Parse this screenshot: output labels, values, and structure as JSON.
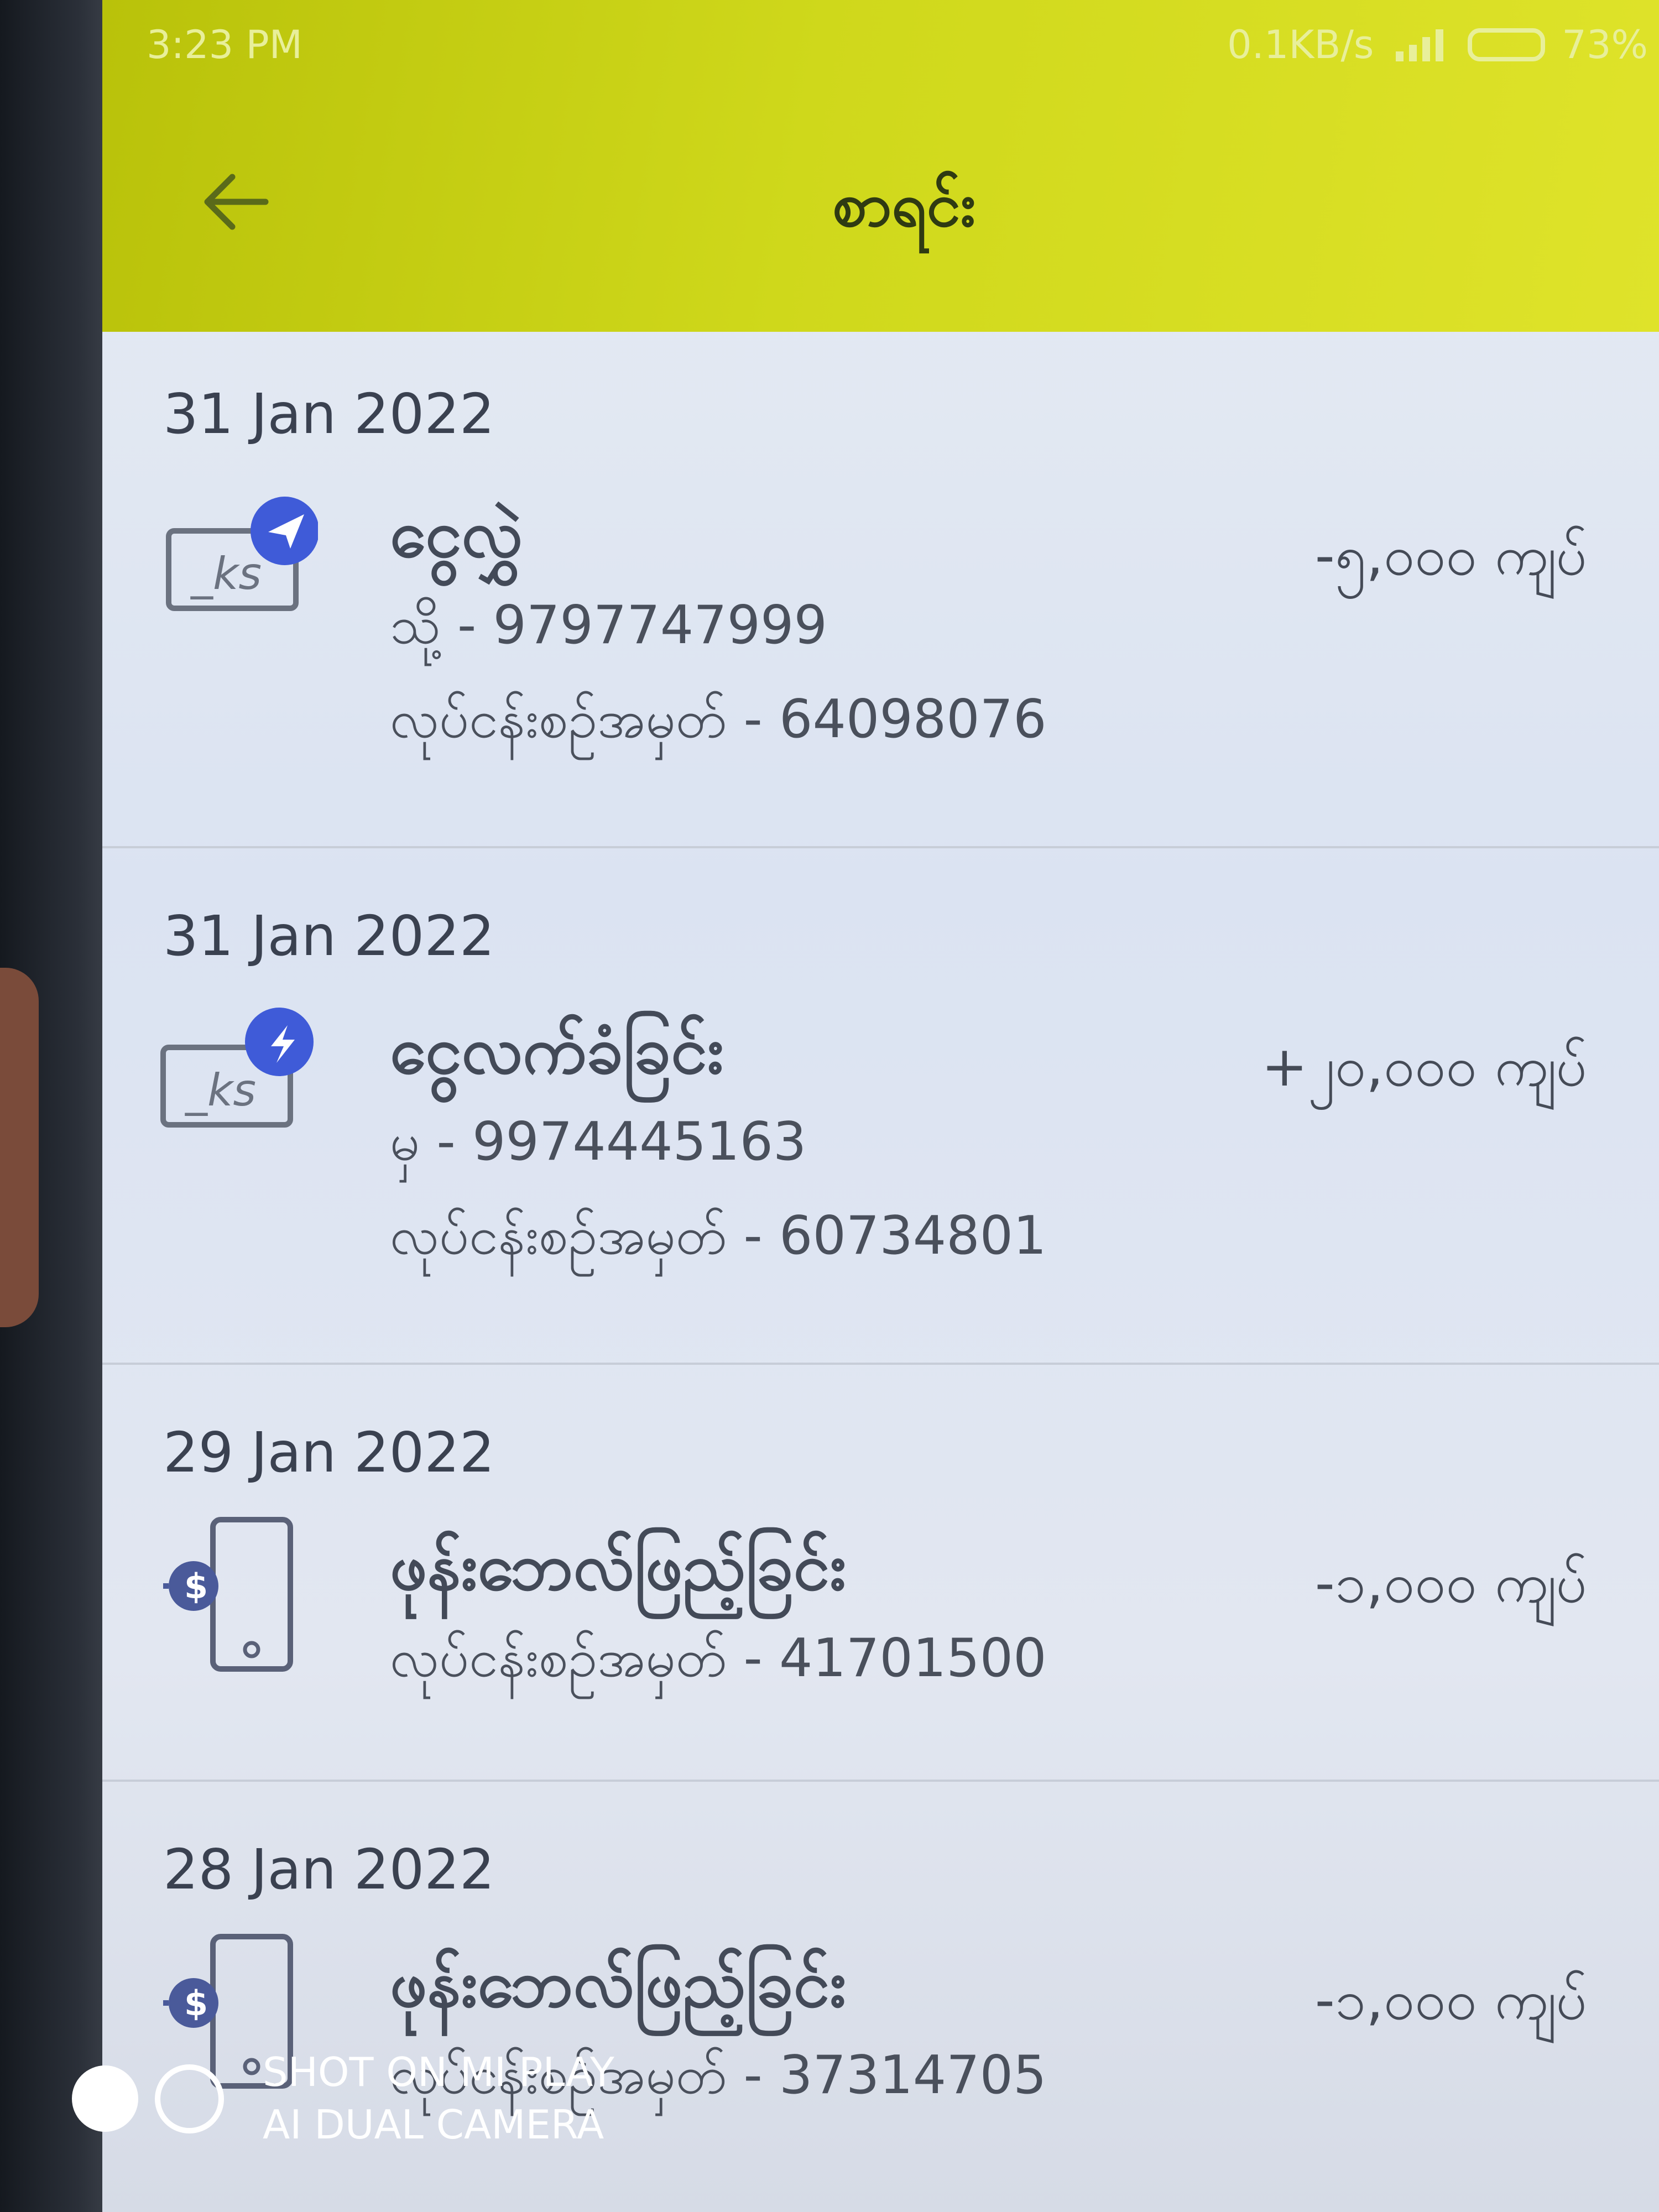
{
  "status_bar": {
    "time": "3:23 PM",
    "speed": "0.1KB/s",
    "battery": "73%"
  },
  "header": {
    "back_icon": "arrow-left-icon",
    "title": "စာရင်း"
  },
  "transactions": [
    {
      "date": "31 Jan 2022",
      "icon": "ks-send-icon",
      "title": "ငွေလွှဲ",
      "line1": "သို့ - 9797747999",
      "line2": "လုပ်ငန်းစဉ်အမှတ် - 64098076",
      "amount": "-၅,၀၀၀ ကျပ်"
    },
    {
      "date": "31 Jan 2022",
      "icon": "ks-receive-icon",
      "title": "ငွေလက်ခံခြင်း",
      "line1": "မှ - 9974445163",
      "line2": "လုပ်ငန်းစဉ်အမှတ် - 60734801",
      "amount": "+၂၀,၀၀၀ ကျပ်"
    },
    {
      "date": "29 Jan 2022",
      "icon": "phone-topup-icon",
      "title": "ဖုန်းဘေလ်ဖြည့်ခြင်း",
      "line1": "လုပ်ငန်းစဉ်အမှတ် - 41701500",
      "amount": "-၁,၀၀၀ ကျပ်"
    },
    {
      "date": "28 Jan 2022",
      "icon": "phone-topup-icon",
      "title": "ဖုန်းဘေလ်ဖြည့်ခြင်း",
      "line1": "လုပ်ငန်းစဉ်အမှတ် - 37314705",
      "amount": "-၁,၀၀၀ ကျပ်"
    }
  ],
  "watermark": {
    "line1": "SHOT ON MI PLAY",
    "line2": "AI DUAL CAMERA"
  },
  "colors": {
    "appbar": "#cfd81b",
    "accent": "#3f5bd8",
    "text": "#434a58"
  }
}
